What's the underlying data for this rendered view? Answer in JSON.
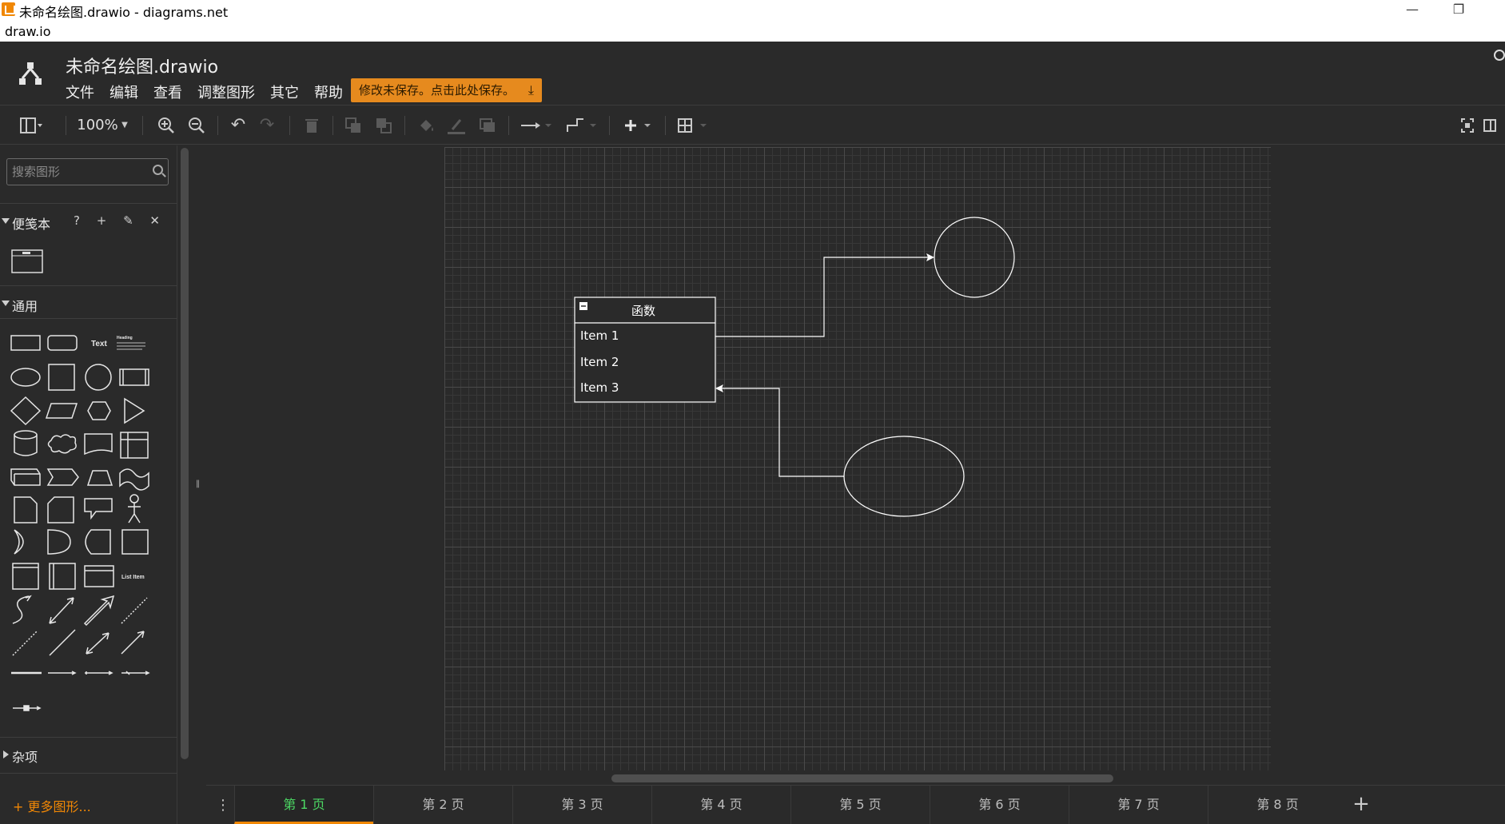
{
  "window": {
    "title": "未命名绘图.drawio - diagrams.net",
    "subtitle": "draw.io",
    "minimize": "—",
    "restore": "❐",
    "close": "✕"
  },
  "header": {
    "doc_title": "未命名绘图.drawio",
    "menu": [
      "文件",
      "编辑",
      "查看",
      "调整图形",
      "其它",
      "帮助"
    ],
    "save_warning": "修改未保存。点击此处保存。",
    "save_icon": "download-icon"
  },
  "toolbar": {
    "zoom": "100%",
    "icons": [
      "layout-icon",
      "zoom-in-icon",
      "zoom-out-icon",
      "undo-icon",
      "redo-icon",
      "delete-icon",
      "to-front-icon",
      "to-back-icon",
      "fill-color-icon",
      "line-color-icon",
      "shadow-icon",
      "connection-icon",
      "waypoints-icon",
      "insert-icon",
      "table-icon",
      "fullscreen-icon",
      "format-panel-icon"
    ]
  },
  "sidebar": {
    "search_placeholder": "搜索图形",
    "scratchpad_label": "便笺本",
    "scratchpad_tools": "? + ✎ ✕",
    "general_label": "通用",
    "misc_label": "杂项",
    "more_shapes": "+ 更多图形...",
    "shape_text": "Text",
    "shape_heading": "Heading",
    "shape_list_item": "List Item"
  },
  "diagram": {
    "class_title": "函数",
    "items": [
      "Item 1",
      "Item 2",
      "Item 3"
    ]
  },
  "tabs": {
    "pages": [
      "第 1 页",
      "第 2 页",
      "第 3 页",
      "第 4 页",
      "第 5 页",
      "第 6 页",
      "第 7 页",
      "第 8 页"
    ],
    "active_index": 0,
    "add": "+"
  },
  "colors": {
    "accent_orange": "#f08705",
    "active_tab_green": "#4cd964",
    "save_warning_bg": "#e68a1e",
    "background": "#2a2a2a"
  }
}
